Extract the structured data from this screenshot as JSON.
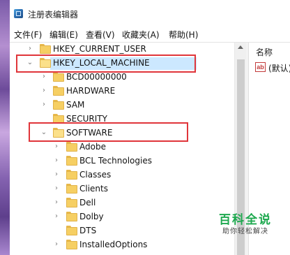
{
  "window": {
    "title": "注册表编辑器"
  },
  "menu": [
    "文件(F)",
    "编辑(E)",
    "查看(V)",
    "收藏夹(A)",
    "帮助(H)"
  ],
  "tree": [
    {
      "label": "HKEY_CURRENT_USER",
      "expander": "collapsed"
    },
    {
      "label": "HKEY_LOCAL_MACHINE",
      "expander": "expanded",
      "highlighted": true
    },
    {
      "label": "BCD00000000",
      "expander": "collapsed"
    },
    {
      "label": "HARDWARE",
      "expander": "collapsed"
    },
    {
      "label": "SAM",
      "expander": "collapsed"
    },
    {
      "label": "SECURITY",
      "expander": "none"
    },
    {
      "label": "SOFTWARE",
      "expander": "expanded",
      "highlighted": true
    },
    {
      "label": "Adobe",
      "expander": "collapsed"
    },
    {
      "label": "BCL Technologies",
      "expander": "collapsed"
    },
    {
      "label": "Classes",
      "expander": "collapsed"
    },
    {
      "label": "Clients",
      "expander": "collapsed"
    },
    {
      "label": "Dell",
      "expander": "collapsed"
    },
    {
      "label": "Dolby",
      "expander": "collapsed"
    },
    {
      "label": "DTS",
      "expander": "none"
    },
    {
      "label": "InstalledOptions",
      "expander": "collapsed"
    }
  ],
  "values_pane": {
    "column_header": "名称",
    "rows": [
      {
        "icon": "ab",
        "name": "(默认)"
      }
    ]
  },
  "watermark": {
    "main": "百科全说",
    "sub": "助你轻松解决"
  },
  "colors": {
    "highlight": "#e0353a",
    "folder": "#f6cf63",
    "watermark": "#1ea94f"
  }
}
